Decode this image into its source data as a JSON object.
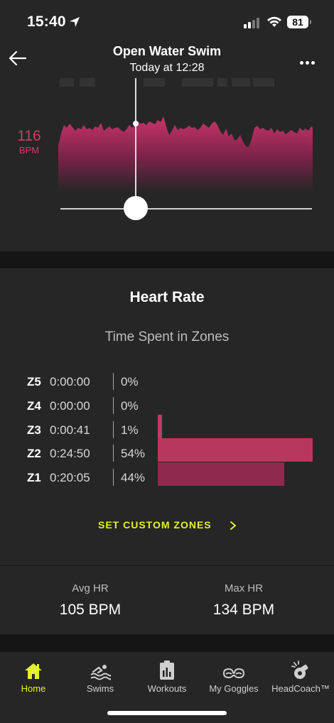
{
  "status_bar": {
    "time": "15:40",
    "battery": "81"
  },
  "header": {
    "title": "Open Water Swim",
    "subtitle": "Today at 12:28"
  },
  "hr_graph": {
    "value": "116",
    "unit": "BPM",
    "accent": "#d23b6a"
  },
  "heart_rate": {
    "title": "Heart Rate",
    "subtitle": "Time Spent in Zones",
    "zones": [
      {
        "label": "Z5",
        "time": "0:00:00",
        "percent": "0%",
        "fraction": 0.0,
        "color": "#c03a66"
      },
      {
        "label": "Z4",
        "time": "0:00:00",
        "percent": "0%",
        "fraction": 0.0,
        "color": "#c03a66"
      },
      {
        "label": "Z3",
        "time": "0:00:41",
        "percent": "1%",
        "fraction": 0.01,
        "color": "#c03a66"
      },
      {
        "label": "Z2",
        "time": "0:24:50",
        "percent": "54%",
        "fraction": 0.54,
        "color": "#b8375e"
      },
      {
        "label": "Z1",
        "time": "0:20:05",
        "percent": "44%",
        "fraction": 0.44,
        "color": "#8e2a4e"
      }
    ],
    "custom_zones": "SET CUSTOM ZONES"
  },
  "stats": {
    "avg": {
      "label": "Avg HR",
      "value": "105 BPM"
    },
    "max": {
      "label": "Max HR",
      "value": "134 BPM"
    }
  },
  "tabs": [
    {
      "label": "Home",
      "icon": "home-icon",
      "active": true
    },
    {
      "label": "Swims",
      "icon": "swimmer-icon",
      "active": false
    },
    {
      "label": "Workouts",
      "icon": "clipboard-icon",
      "active": false
    },
    {
      "label": "My Goggles",
      "icon": "goggles-icon",
      "active": false
    },
    {
      "label": "HeadCoach™",
      "icon": "whistle-icon",
      "active": false
    }
  ],
  "colors": {
    "accent_yellow": "#e4f12a",
    "hr_pink": "#d23b6a"
  }
}
